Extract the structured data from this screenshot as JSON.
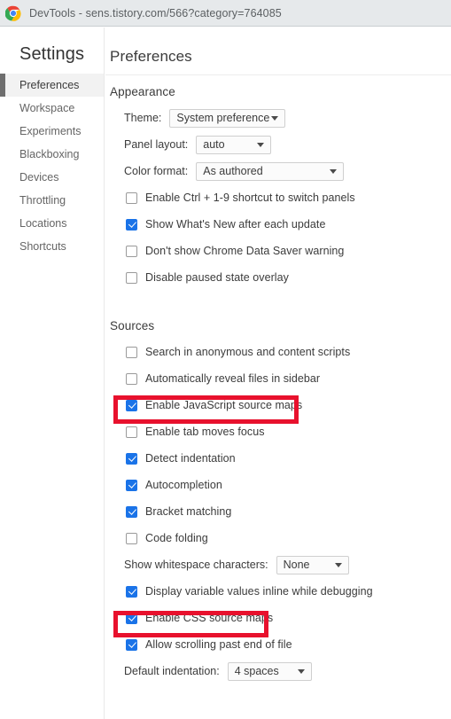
{
  "titlebar": {
    "icon": "chrome-logo-icon",
    "text": "DevTools - sens.tistory.com/566?category=764085"
  },
  "sidebar": {
    "heading": "Settings",
    "items": [
      {
        "label": "Preferences",
        "selected": true
      },
      {
        "label": "Workspace",
        "selected": false
      },
      {
        "label": "Experiments",
        "selected": false
      },
      {
        "label": "Blackboxing",
        "selected": false
      },
      {
        "label": "Devices",
        "selected": false
      },
      {
        "label": "Throttling",
        "selected": false
      },
      {
        "label": "Locations",
        "selected": false
      },
      {
        "label": "Shortcuts",
        "selected": false
      }
    ]
  },
  "main": {
    "title": "Preferences",
    "appearance": {
      "heading": "Appearance",
      "theme": {
        "label": "Theme:",
        "value": "System preference"
      },
      "panel_layout": {
        "label": "Panel layout:",
        "value": "auto"
      },
      "color_format": {
        "label": "Color format:",
        "value": "As authored"
      },
      "checkboxes": [
        {
          "label": "Enable Ctrl + 1-9 shortcut to switch panels",
          "checked": false
        },
        {
          "label": "Show What's New after each update",
          "checked": true
        },
        {
          "label": "Don't show Chrome Data Saver warning",
          "checked": false
        },
        {
          "label": "Disable paused state overlay",
          "checked": false
        }
      ]
    },
    "sources": {
      "heading": "Sources",
      "checkboxes_top": [
        {
          "label": "Search in anonymous and content scripts",
          "checked": false
        },
        {
          "label": "Automatically reveal files in sidebar",
          "checked": false
        },
        {
          "label": "Enable JavaScript source maps",
          "checked": true,
          "highlighted": true
        },
        {
          "label": "Enable tab moves focus",
          "checked": false
        },
        {
          "label": "Detect indentation",
          "checked": true
        },
        {
          "label": "Autocompletion",
          "checked": true
        },
        {
          "label": "Bracket matching",
          "checked": true
        },
        {
          "label": "Code folding",
          "checked": false
        }
      ],
      "whitespace": {
        "label": "Show whitespace characters:",
        "value": "None"
      },
      "checkboxes_bottom": [
        {
          "label": "Display variable values inline while debugging",
          "checked": true
        },
        {
          "label": "Enable CSS source maps",
          "checked": true,
          "highlighted": true
        },
        {
          "label": "Allow scrolling past end of file",
          "checked": true
        }
      ],
      "default_indentation": {
        "label": "Default indentation:",
        "value": "4 spaces"
      }
    }
  },
  "colors": {
    "titlebar_bg": "#e6e9eb",
    "accent_checkbox": "#1a73e8",
    "annotation_red": "#e8112d",
    "selected_nav_bar": "#6e6e6e",
    "selected_nav_bg": "#f2f2f2"
  }
}
